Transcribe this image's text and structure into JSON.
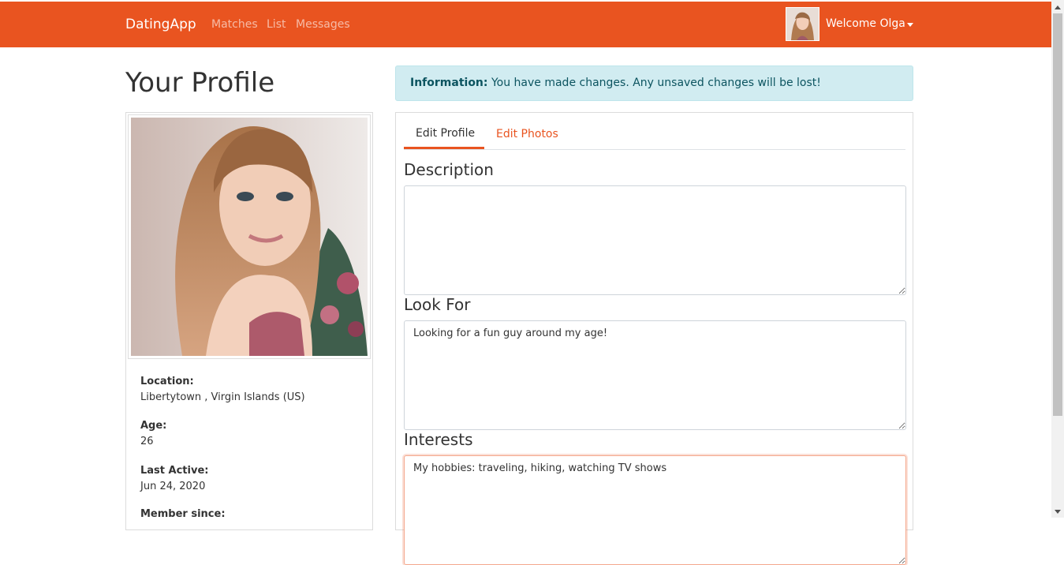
{
  "navbar": {
    "brand": "DatingApp",
    "links": [
      "Matches",
      "List",
      "Messages"
    ],
    "welcome": "Welcome Olga",
    "color": "#e95420"
  },
  "page": {
    "title": "Your Profile"
  },
  "alert": {
    "strong": "Information:",
    "message": "You have made changes. Any unsaved changes will be lost!"
  },
  "profile": {
    "location_label": "Location:",
    "location_value": "Libertytown , Virgin Islands (US)",
    "age_label": "Age:",
    "age_value": "26",
    "last_active_label": "Last Active:",
    "last_active_value": "Jun 24, 2020",
    "member_since_label": "Member since:"
  },
  "tabs": {
    "edit_profile": "Edit Profile",
    "edit_photos": "Edit Photos"
  },
  "form": {
    "description_label": "Description",
    "description_value": "",
    "look_for_label": "Look For",
    "look_for_value": "Looking for a fun guy around my age!",
    "interests_label": "Interests",
    "interests_value": "My hobbies: traveling, hiking, watching TV shows"
  }
}
